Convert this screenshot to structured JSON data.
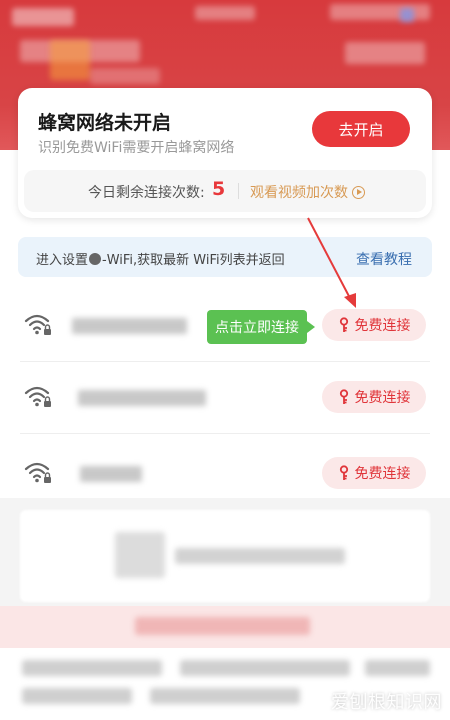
{
  "cellular_card": {
    "title": "蜂窝网络未开启",
    "subtitle": "识别免费WiFi需要开启蜂窝网络",
    "open_button": "去开启",
    "remaining_label": "今日剩余连接次数:",
    "remaining_count": "5",
    "watch_video_link": "观看视频加次数"
  },
  "tip_bar": {
    "text_before": "进入设置",
    "text_after": "-WiFi,获取最新 WiFi列表并返回",
    "link": "查看教程"
  },
  "tooltip": "点击立即连接",
  "wifi_list": [
    {
      "free_button": "免费连接",
      "icon": "wifi-locked-icon"
    },
    {
      "free_button": "免费连接",
      "icon": "wifi-locked-icon"
    },
    {
      "free_button": "免费连接",
      "icon": "wifi-locked-icon"
    }
  ],
  "watermark": "爱刨根知识网",
  "colors": {
    "brand_red": "#e8383b",
    "header_red": "#d73a3d",
    "tooltip_green": "#5bc152",
    "link_blue": "#3a6fb0",
    "video_gold": "#d89a54"
  }
}
